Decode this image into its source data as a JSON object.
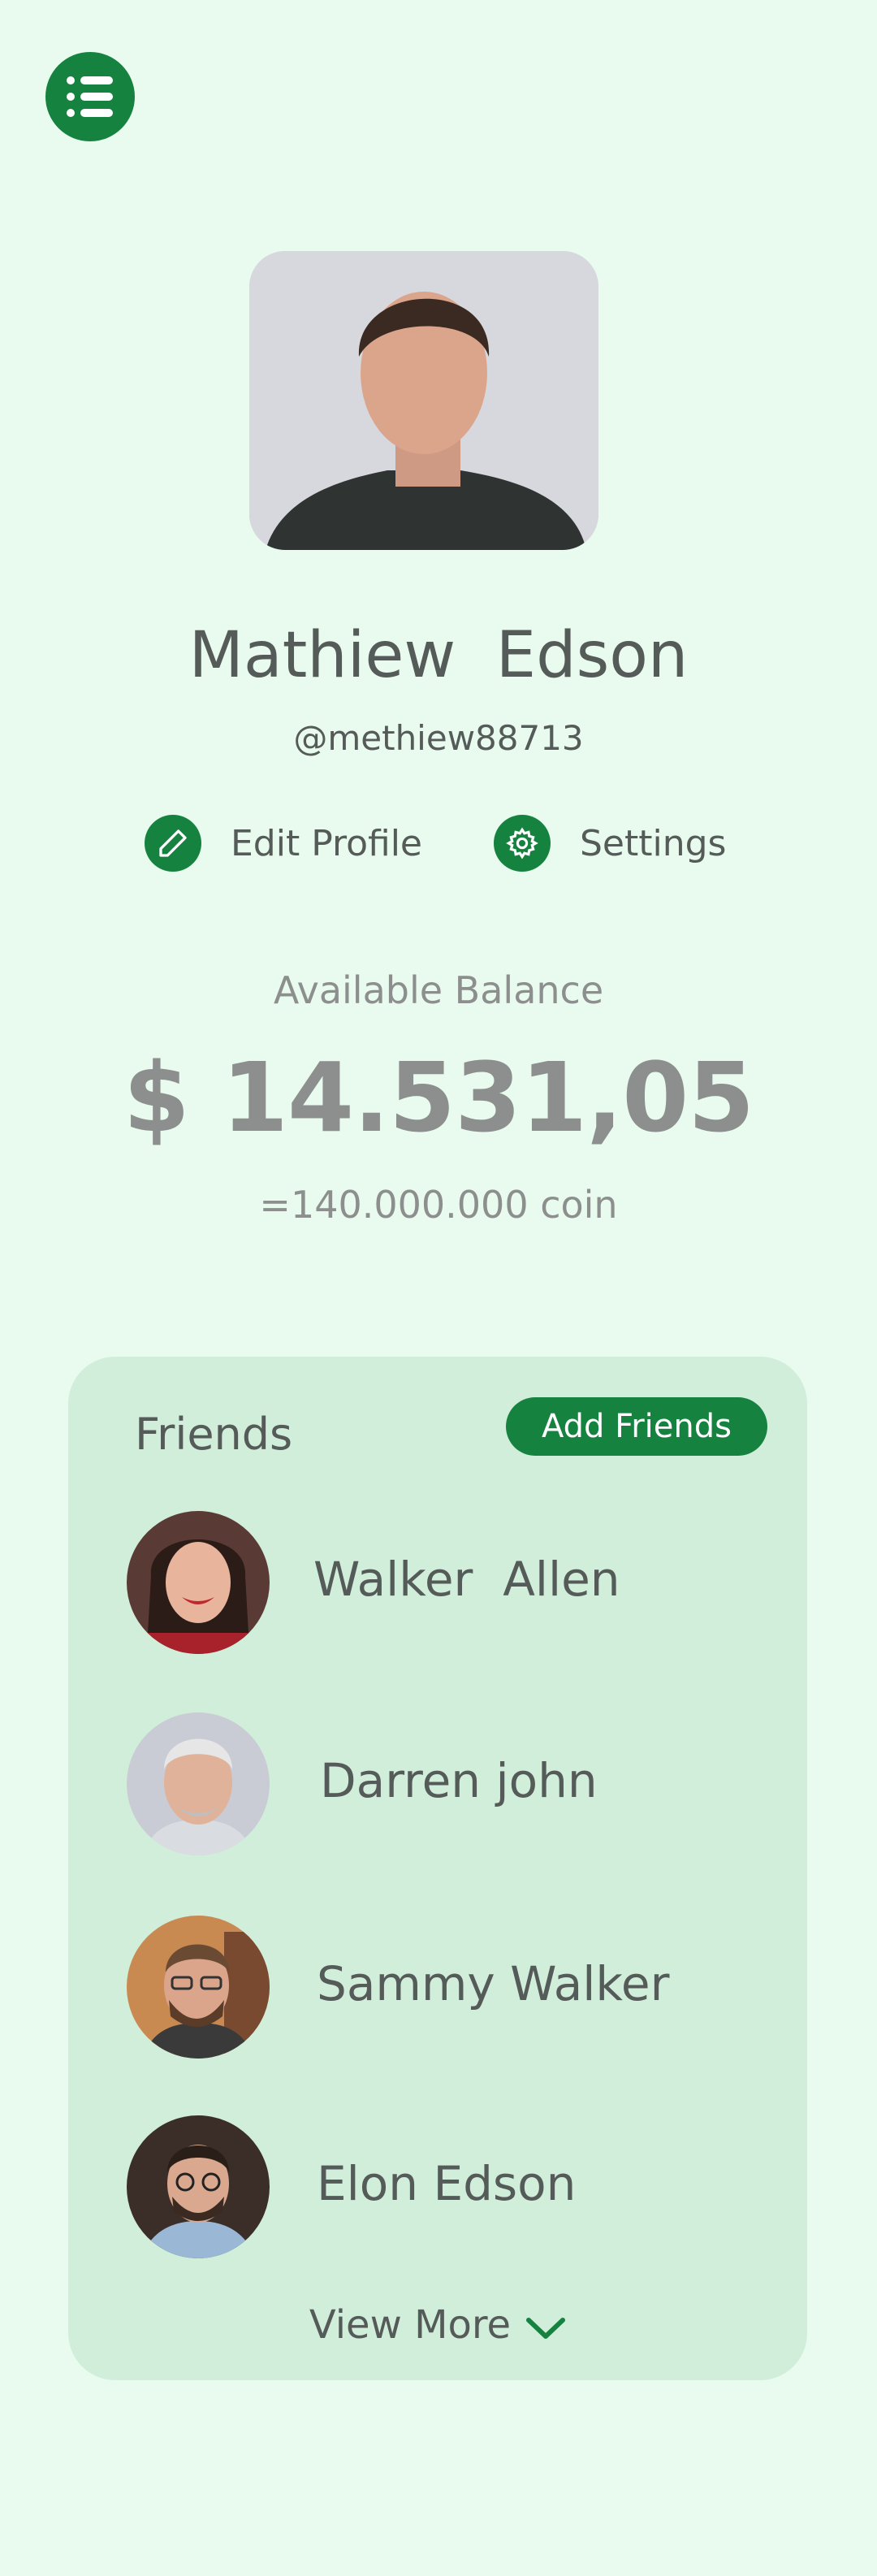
{
  "header": {
    "menu_icon": "list-menu-icon"
  },
  "profile": {
    "name": "Mathiew  Edson",
    "handle": "@methiew88713",
    "edit_label": "Edit Profile",
    "settings_label": "Settings"
  },
  "balance": {
    "label": "Available Balance",
    "amount": "$ 14.531,05",
    "coin": "=140.000.000 coin"
  },
  "friends": {
    "title": "Friends",
    "add_label": "Add Friends",
    "items": [
      {
        "name": "Walker  Allen"
      },
      {
        "name": "Darren john"
      },
      {
        "name": "Sammy Walker"
      },
      {
        "name": "Elon Edson"
      }
    ],
    "view_more": "View More"
  },
  "colors": {
    "accent": "#16823f",
    "background": "#e8fbee",
    "card": "#d0eeda"
  }
}
